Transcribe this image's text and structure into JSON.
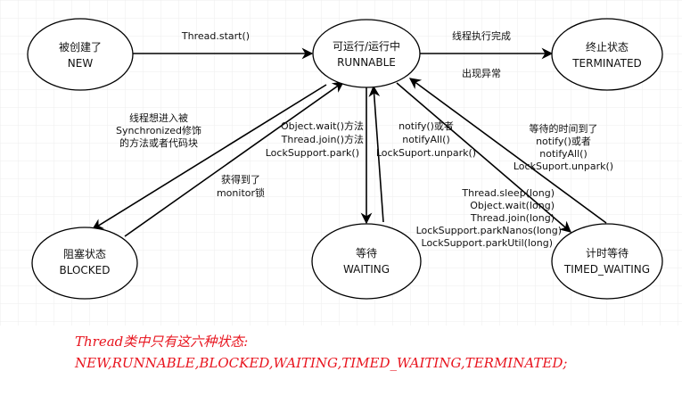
{
  "states": {
    "new": {
      "line1": "被创建了",
      "line2": "NEW"
    },
    "runnable": {
      "line1": "可运行/运行中",
      "line2": "RUNNABLE"
    },
    "terminated": {
      "line1": "终止状态",
      "line2": "TERMINATED"
    },
    "blocked": {
      "line1": "阻塞状态",
      "line2": "BLOCKED"
    },
    "waiting": {
      "line1": "等待",
      "line2": "WAITING"
    },
    "timed_waiting": {
      "line1": "计时等待",
      "line2": "TIMED_WAITING"
    }
  },
  "transitions": {
    "new_to_runnable": [
      "Thread.start()"
    ],
    "runnable_to_terminated": [
      "线程执行完成",
      "出现异常"
    ],
    "runnable_to_blocked": [
      "线程想进入被",
      "Synchronized修饰",
      "的方法或者代码块"
    ],
    "blocked_to_runnable": [
      "获得到了",
      "monitor锁"
    ],
    "runnable_to_waiting": [
      "Object.wait()方法",
      "Thread.join()方法",
      "LockSupport.park()"
    ],
    "waiting_to_runnable": [
      "notify()或者",
      "notifyAll()",
      "LockSuport.unpark()"
    ],
    "runnable_to_timed_waiting": [
      "Thread.sleep(long)",
      "Object.wait(long)",
      "Thread.join(long)",
      "LockSupport.parkNanos(long)",
      "LockSupport.parkUtil(long)"
    ],
    "timed_waiting_to_runnable": [
      "等待的时间到了",
      "notify()或者",
      "notifyAll()",
      "LockSuport.unpark()"
    ]
  },
  "note": {
    "line1": "Thread类中只有这六种状态:",
    "line2": "NEW,RUNNABLE,BLOCKED,WAITING,TIMED_WAITING,TERMINATED;"
  },
  "colors": {
    "stroke": "#000000",
    "grid": "#eeeeee",
    "note": "#e8141e"
  }
}
